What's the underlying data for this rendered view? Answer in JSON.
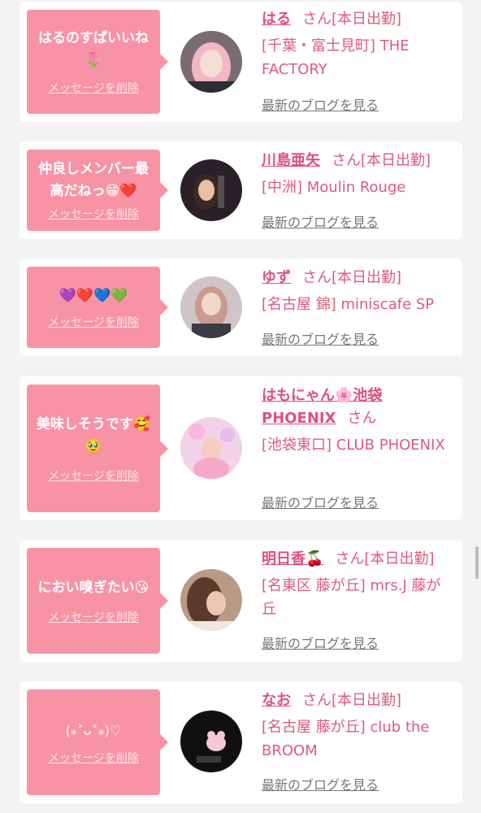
{
  "delete_label": "メッセージを削除",
  "blog_label": "最新のブログを見る",
  "san_label": "さん",
  "colors": {
    "bubble": "#f893a6",
    "accent": "#e0507a",
    "background": "#f3f3f3"
  },
  "items": [
    {
      "message": "はるのすぱいいね🌷",
      "name": "はる",
      "status": "[本日出勤]",
      "shop": "[千葉・富士見町] THE FACTORY"
    },
    {
      "message": "仲良しメンバー最高だねっ😁❤️",
      "name": "川島亜矢",
      "status": "[本日出勤]",
      "shop": "[中洲] Moulin Rouge"
    },
    {
      "message": "💜❤️💙💚",
      "name": "ゆず",
      "status": "[本日出勤]",
      "shop": "[名古屋 錦] miniscafe SP"
    },
    {
      "message": "美味しそうです🥰🥹",
      "name": "はもにゃん🌸池袋PHOENIX",
      "status": "",
      "shop": "[池袋東口] CLUB PHOENIX"
    },
    {
      "message": "におい嗅ぎたい😘",
      "name": "明日香🍒",
      "status": "[本日出勤]",
      "shop": "[名東区 藤が丘] mrs.J 藤が丘"
    },
    {
      "message": "(⁎˃ᴗ˂⁎)♡",
      "name": "なお",
      "status": "[本日出勤]",
      "shop": "[名古屋 藤が丘] club the BROOM"
    }
  ]
}
